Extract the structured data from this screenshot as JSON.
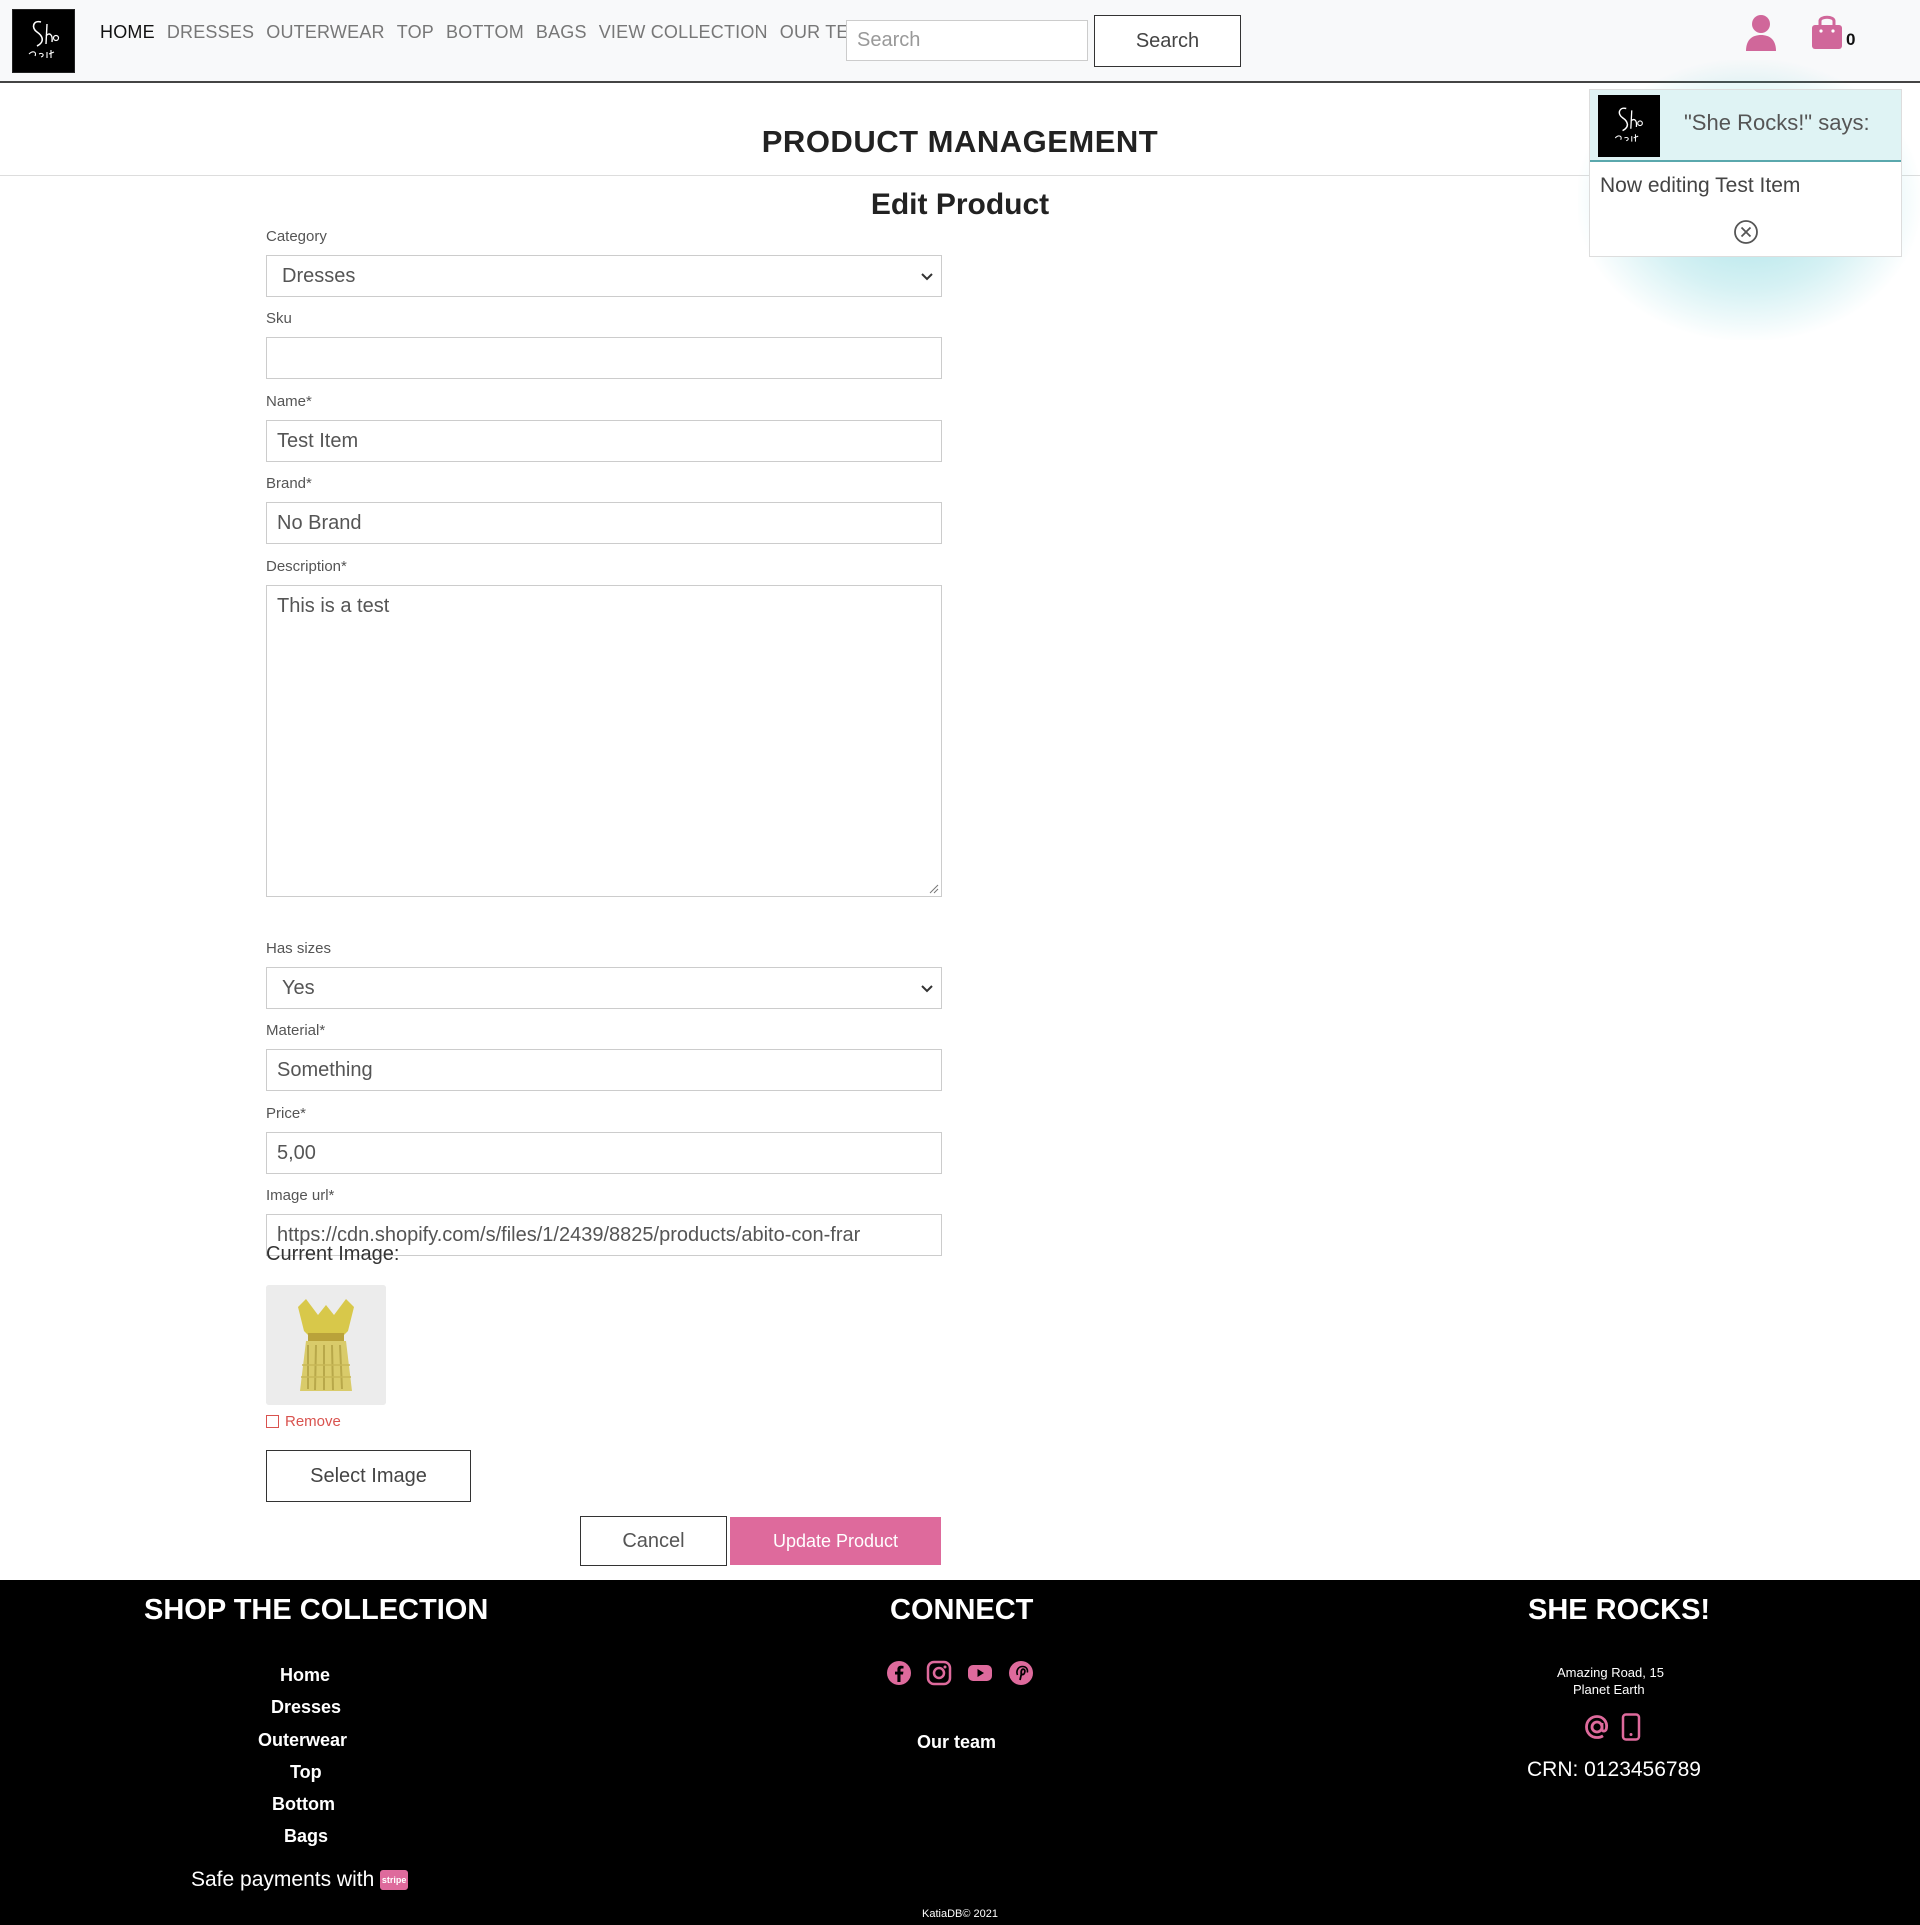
{
  "nav": {
    "logo_alt": "She Rocks logo",
    "links": [
      {
        "label": "HOME",
        "active": true
      },
      {
        "label": "DRESSES"
      },
      {
        "label": "OUTERWEAR"
      },
      {
        "label": "TOP"
      },
      {
        "label": "BOTTOM"
      },
      {
        "label": "BAGS"
      },
      {
        "label": "VIEW COLLECTION"
      },
      {
        "label": "OUR TEAM"
      }
    ],
    "search_placeholder": "Search",
    "search_button": "Search",
    "bag_count": "0",
    "icons": {
      "user": "user-icon",
      "bag": "shopping-bag-icon"
    }
  },
  "page": {
    "title": "PRODUCT MANAGEMENT",
    "form_title": "Edit Product"
  },
  "form": {
    "category": {
      "label": "Category",
      "value": "Dresses"
    },
    "sku": {
      "label": "Sku",
      "value": ""
    },
    "name": {
      "label": "Name*",
      "value": "Test Item"
    },
    "brand": {
      "label": "Brand*",
      "value": "No Brand"
    },
    "description": {
      "label": "Description*",
      "value": "This is a test"
    },
    "has_sizes": {
      "label": "Has sizes",
      "value": "Yes"
    },
    "material": {
      "label": "Material*",
      "value": "Something"
    },
    "price": {
      "label": "Price*",
      "value": "5,00"
    },
    "image_url": {
      "label": "Image url*",
      "value": "https://cdn.shopify.com/s/files/1/2439/8825/products/abito-con-frar"
    },
    "current_image_label": "Current Image:",
    "remove_label": "Remove",
    "select_image_button": "Select Image",
    "cancel_button": "Cancel",
    "update_button": "Update Product"
  },
  "toast": {
    "title": "\"She Rocks!\" says:",
    "message": "Now editing Test Item"
  },
  "footer": {
    "shop": {
      "heading": "SHOP THE COLLECTION",
      "links": [
        "Home",
        "Dresses",
        "Outerwear",
        "Top",
        "Bottom",
        "Bags"
      ],
      "payments": "Safe payments with",
      "stripe": "stripe"
    },
    "connect": {
      "heading": "CONNECT",
      "social_icons": [
        "facebook-icon",
        "instagram-icon",
        "youtube-icon",
        "pinterest-icon"
      ],
      "team_link": "Our team"
    },
    "brand": {
      "heading": "SHE ROCKS!",
      "address_line1": "Amazing Road, 15",
      "address_line2": "Planet Earth",
      "crn": "CRN: 0123456789"
    },
    "copyright": "KatiaDB© 2021"
  },
  "colors": {
    "accent": "#de6a9c",
    "toast_header": "#dff3f4",
    "footer_bg": "#000000"
  }
}
